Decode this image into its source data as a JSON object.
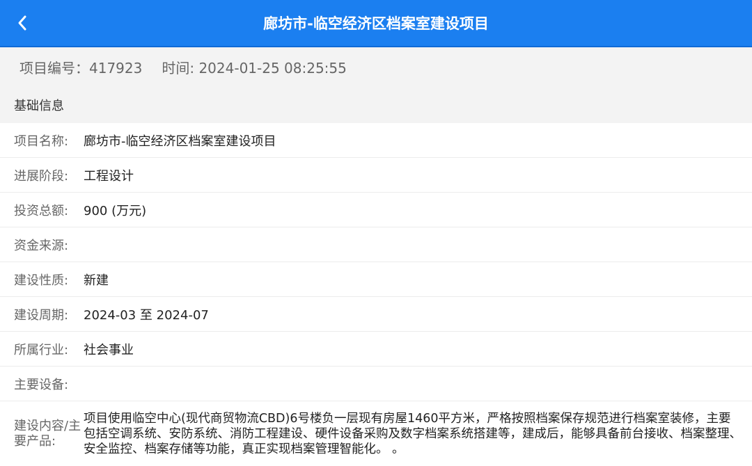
{
  "header": {
    "title": "廊坊市-临空经济区档案室建设项目",
    "back_icon": "chevron-left-icon",
    "color": "#1b7ff0"
  },
  "meta": {
    "project_no": "项目编号：417923",
    "time": "时间: 2024-01-25 08:25:55"
  },
  "section": {
    "title": "基础信息"
  },
  "fields": [
    {
      "label": "项目名称:",
      "value": "廊坊市-临空经济区档案室建设项目"
    },
    {
      "label": "进展阶段:",
      "value": "工程设计"
    },
    {
      "label": "投资总额:",
      "value": "900 (万元)"
    },
    {
      "label": "资金来源:",
      "value": ""
    },
    {
      "label": "建设性质:",
      "value": "新建"
    },
    {
      "label": "建设周期:",
      "value": "2024-03 至 2024-07"
    },
    {
      "label": "所属行业:",
      "value": "社会事业"
    },
    {
      "label": "主要设备:",
      "value": ""
    },
    {
      "label": "建设内容/主要产品:",
      "value": "项目使用临空中心(现代商贸物流CBD)6号楼负一层现有房屋1460平方米，严格按照档案保存规范进行档案室装修，主要包括空调系统、安防系统、消防工程建设、硬件设备采购及数字档案系统搭建等，建成后，能够具备前台接收、档案整理、安全监控、档案存储等功能，真正实现档案管理智能化。 。"
    }
  ]
}
